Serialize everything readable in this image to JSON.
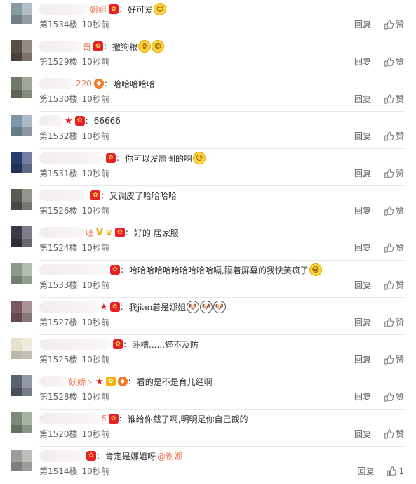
{
  "comments": [
    {
      "floor": "第1534楼",
      "time": "10秒前",
      "name_tail": "姐姐",
      "badges": [
        "fan"
      ],
      "text": "好可爱",
      "emojis": [
        "😊"
      ],
      "mention": "",
      "reply": "回复",
      "like": "赞",
      "avatar_color": "#8a9aa4",
      "blur_w": 70
    },
    {
      "floor": "第1529楼",
      "time": "10秒前",
      "name_tail": "哥",
      "badges": [
        "fan"
      ],
      "text": "撒狗粮",
      "emojis": [
        "😌",
        "😌"
      ],
      "mention": "",
      "reply": "回复",
      "like": "赞",
      "avatar_color": "#5b4d48",
      "blur_w": 60
    },
    {
      "floor": "第1530楼",
      "time": "10秒前",
      "name_tail": "220",
      "badges": [
        "orange"
      ],
      "text": "哈哈哈哈哈",
      "emojis": [],
      "mention": "",
      "reply": "回复",
      "like": "赞",
      "avatar_color": "#6f7a66",
      "blur_w": 50
    },
    {
      "floor": "第1532楼",
      "time": "10秒前",
      "name_tail": "",
      "badges": [
        "star",
        "fan"
      ],
      "text": "66666",
      "emojis": [],
      "mention": "",
      "reply": "回复",
      "like": "赞",
      "avatar_color": "#7f96a8",
      "blur_w": 34
    },
    {
      "floor": "第1531楼",
      "time": "10秒前",
      "name_tail": "",
      "badges": [
        "fan"
      ],
      "text": "你可以发原图的啊",
      "emojis": [
        "😉"
      ],
      "mention": "",
      "reply": "回复",
      "like": "赞",
      "avatar_color": "#2b3b6c",
      "blur_w": 92
    },
    {
      "floor": "第1526楼",
      "time": "10秒前",
      "name_tail": "",
      "badges": [
        "fan"
      ],
      "text": "又调皮了哈哈哈哈",
      "emojis": [],
      "mention": "",
      "reply": "回复",
      "like": "赞",
      "avatar_color": "#5a5a52",
      "blur_w": 70
    },
    {
      "floor": "第1524楼",
      "time": "10秒前",
      "name_tail": "吐",
      "badges": [
        "v",
        "crown",
        "fan"
      ],
      "text": "好的 居家服",
      "emojis": [],
      "mention": "",
      "reply": "回复",
      "like": "赞",
      "avatar_color": "#3a3a48",
      "blur_w": 64
    },
    {
      "floor": "第1533楼",
      "time": "10秒前",
      "name_tail": "",
      "badges": [
        "fan"
      ],
      "text": "哈哈哈哈哈哈哈哈哈哈嗝,隔着屏幕的我快笑疯了",
      "emojis": [
        "😂"
      ],
      "mention": "",
      "reply": "回复",
      "like": "赞",
      "avatar_color": "#8c9a8a",
      "blur_w": 98
    },
    {
      "floor": "第1527楼",
      "time": "10秒前",
      "name_tail": "",
      "badges": [
        "star",
        "fan"
      ],
      "text": "我jiao着是娜姐",
      "emojis": [
        "🐶",
        "🐶",
        "🐶"
      ],
      "mention": "",
      "reply": "回复",
      "like": "赞",
      "avatar_color": "#7a5a5e",
      "blur_w": 84
    },
    {
      "floor": "第1525楼",
      "time": "10秒前",
      "name_tail": "",
      "badges": [
        "fan"
      ],
      "text": "卧槽......猝不及防",
      "emojis": [],
      "mention": "",
      "reply": "回复",
      "like": "赞",
      "avatar_color": "#e6e0cc",
      "blur_w": 102
    },
    {
      "floor": "第1528楼",
      "time": "10秒前",
      "name_tail": "妖娇丶",
      "badges": [
        "star",
        "fan2",
        "orange"
      ],
      "text": "看的是不是育儿经啊",
      "emojis": [],
      "mention": "",
      "reply": "回复",
      "like": "赞",
      "avatar_color": "#5a6270",
      "blur_w": 40
    },
    {
      "floor": "第1520楼",
      "time": "10秒前",
      "name_tail": "6",
      "badges": [
        "fan"
      ],
      "text": "谁给你截了啊,明明是你自己截的",
      "emojis": [],
      "mention": "",
      "reply": "回复",
      "like": "赞",
      "avatar_color": "#7a8a74",
      "blur_w": 86
    },
    {
      "floor": "第1514楼",
      "time": "10秒前",
      "name_tail": "",
      "badges": [
        "fan"
      ],
      "text": "肯定是娜姐呀",
      "emojis": [],
      "mention": "@谢娜",
      "reply": "回复",
      "like": "1",
      "avatar_color": "#9a9d98",
      "blur_w": 64
    }
  ],
  "colors": {
    "accent": "#eb7350",
    "badge_red": "#e8202a",
    "text": "#333333",
    "meta": "#666666"
  }
}
